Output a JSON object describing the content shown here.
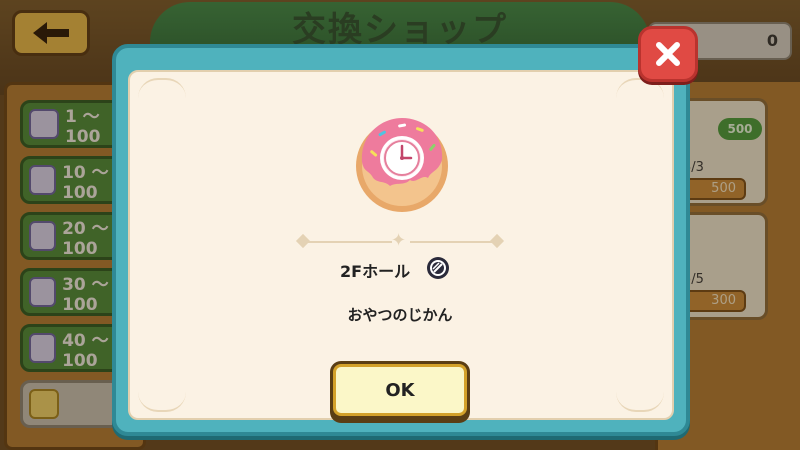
{
  "background": {
    "title": "交換ショップ",
    "coins": "0",
    "left_list": [
      {
        "label": "1 〜100"
      },
      {
        "label": "10 〜100"
      },
      {
        "label": "20 〜100"
      },
      {
        "label": "30 〜100"
      },
      {
        "label": "40 〜100"
      }
    ],
    "right_cards": [
      {
        "count": "3/3",
        "price": "500"
      },
      {
        "count": "5/5",
        "price": "300"
      }
    ],
    "bubble_price": "500"
  },
  "modal": {
    "item_icon": "donut-clock-icon",
    "item_name": "2Fホール",
    "badge_icon": "gear-badge-icon",
    "item_description": "おやつのじかん",
    "ok_label": "OK",
    "close_icon": "close-icon"
  },
  "colors": {
    "modal_border": "#4fb2bd",
    "modal_body": "#fbf2e4",
    "close_button": "#e04a44",
    "ok_button": "#fbf7c8"
  }
}
